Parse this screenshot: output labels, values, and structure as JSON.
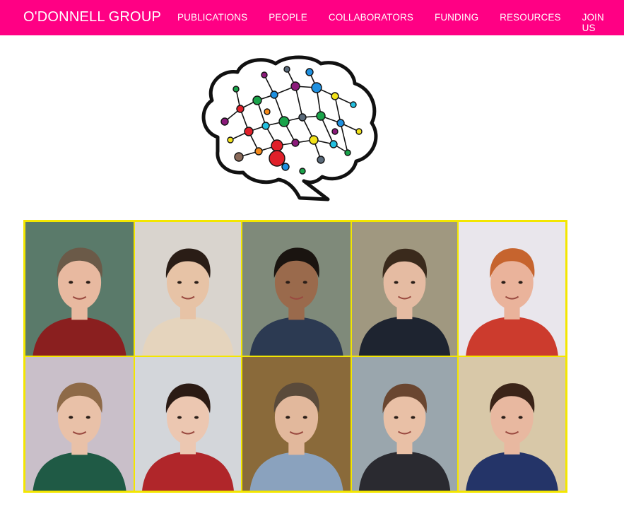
{
  "navbar": {
    "brand": "O'DONNELL GROUP",
    "links": [
      "PUBLICATIONS",
      "PEOPLE",
      "COLLABORATORS",
      "FUNDING",
      "RESOURCES",
      "JOIN US"
    ],
    "background": "#ff0084",
    "text_color": "#ffffff"
  },
  "logo": {
    "icon": "brain-network-icon"
  },
  "team_grid": {
    "border_color": "#f3e600",
    "photos": [
      {
        "icon": "person-photo",
        "bg": "#5a7a6a",
        "skin": "#e8b9a0",
        "hair": "#6b5a48",
        "shirt": "#8a1f1f"
      },
      {
        "icon": "person-photo",
        "bg": "#d9d4ce",
        "skin": "#e7c3a6",
        "hair": "#2a1d16",
        "shirt": "#e5d4bd"
      },
      {
        "icon": "person-photo",
        "bg": "#7f8a7a",
        "skin": "#9a6a4c",
        "hair": "#1a1410",
        "shirt": "#2c3a52"
      },
      {
        "icon": "person-photo",
        "bg": "#a09880",
        "skin": "#e5bba2",
        "hair": "#3a2a1c",
        "shirt": "#1e2430"
      },
      {
        "icon": "person-photo",
        "bg": "#e9e6ec",
        "skin": "#eab39b",
        "hair": "#c6642e",
        "shirt": "#cc3b2d"
      },
      {
        "icon": "person-photo",
        "bg": "#c9bfc9",
        "skin": "#e9c1a8",
        "hair": "#8e6a48",
        "shirt": "#1f5a45"
      },
      {
        "icon": "person-photo",
        "bg": "#d3d6da",
        "skin": "#ecc7b1",
        "hair": "#2b1b14",
        "shirt": "#b0262a"
      },
      {
        "icon": "person-photo",
        "bg": "#8a6a3a",
        "skin": "#e2b89c",
        "hair": "#5a4a3a",
        "shirt": "#8aa2be"
      },
      {
        "icon": "person-photo",
        "bg": "#9aa6ad",
        "skin": "#e9c0a6",
        "hair": "#6a4630",
        "shirt": "#2a2a30"
      },
      {
        "icon": "person-photo",
        "bg": "#d8c8a8",
        "skin": "#e8b8a0",
        "hair": "#3b2418",
        "shirt": "#243468"
      }
    ]
  }
}
